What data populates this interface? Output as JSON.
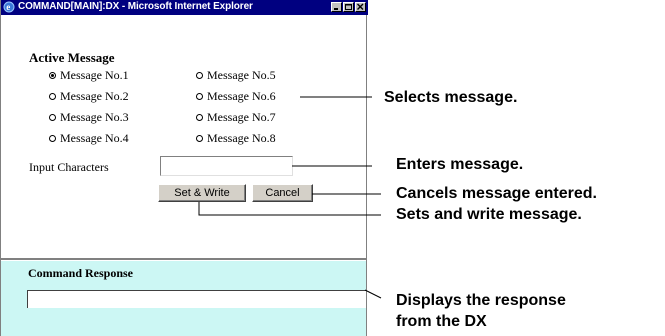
{
  "window": {
    "title": "COMMAND[MAIN]:DX - Microsoft Internet Explorer",
    "controls": [
      "minimize-icon",
      "maximize-icon",
      "close-icon"
    ]
  },
  "active_message": {
    "heading": "Active Message",
    "options": [
      {
        "label": "Message No.1",
        "selected": true
      },
      {
        "label": "Message No.2",
        "selected": false
      },
      {
        "label": "Message No.3",
        "selected": false
      },
      {
        "label": "Message No.4",
        "selected": false
      },
      {
        "label": "Message No.5",
        "selected": false
      },
      {
        "label": "Message No.6",
        "selected": false
      },
      {
        "label": "Message No.7",
        "selected": false
      },
      {
        "label": "Message No.8",
        "selected": false
      }
    ]
  },
  "input": {
    "label": "Input Characters",
    "value": ""
  },
  "buttons": {
    "set_write": "Set & Write",
    "cancel": "Cancel"
  },
  "response": {
    "heading": "Command Response",
    "value": ""
  },
  "callouts": {
    "selects": "Selects message.",
    "enters": "Enters message.",
    "cancels": "Cancels message entered.",
    "sets": "Sets and write message.",
    "displays_line1": "Displays the response",
    "displays_line2": "from the DX"
  },
  "colors": {
    "titlebar": "#000080",
    "response_panel": "#ccf7f4",
    "button_face": "#d4d0c8"
  }
}
